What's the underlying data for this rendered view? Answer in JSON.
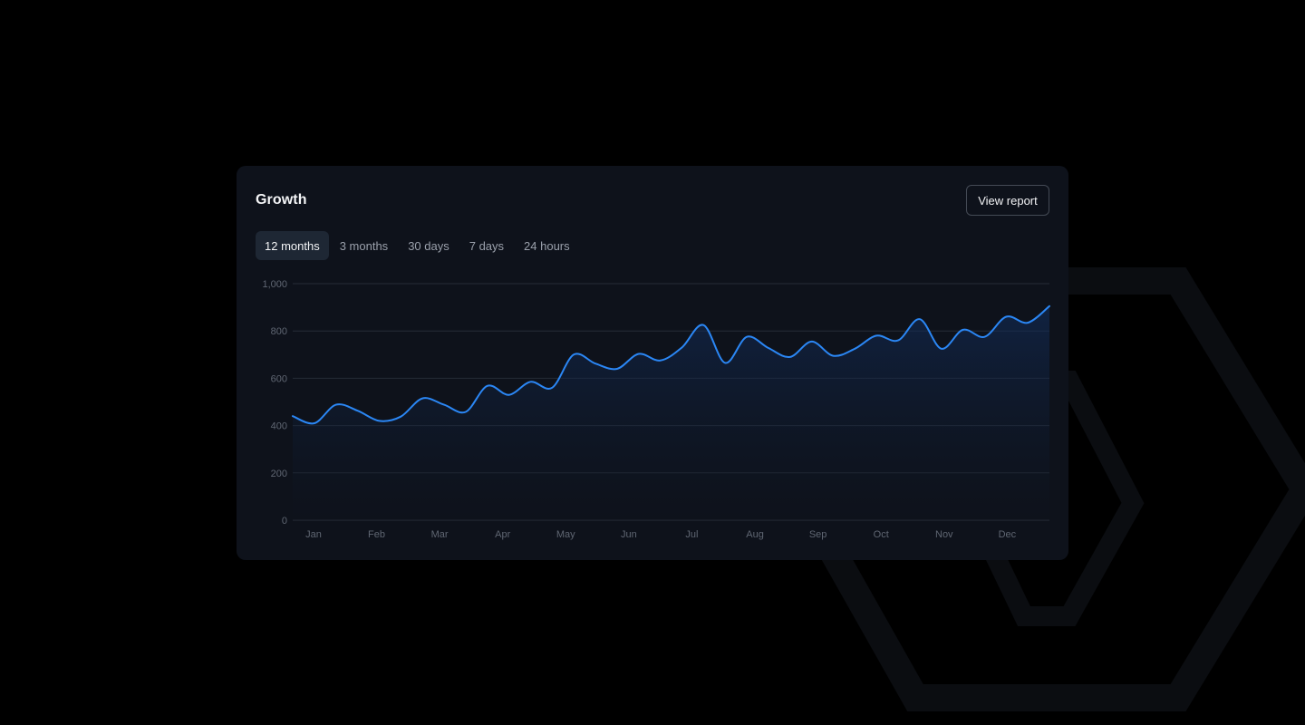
{
  "card": {
    "title": "Growth",
    "view_report_label": "View report",
    "tabs": [
      {
        "label": "12 months",
        "active": true
      },
      {
        "label": "3 months",
        "active": false
      },
      {
        "label": "30 days",
        "active": false
      },
      {
        "label": "7 days",
        "active": false
      },
      {
        "label": "24 hours",
        "active": false
      }
    ]
  },
  "colors": {
    "line": "#2b87f5",
    "grid": "#262c37",
    "card_bg": "#0e121b",
    "tab_active_bg": "#1e2734"
  },
  "chart_data": {
    "type": "area",
    "categories": [
      "Jan",
      "Feb",
      "Mar",
      "Apr",
      "May",
      "Jun",
      "Jul",
      "Aug",
      "Sep",
      "Oct",
      "Nov",
      "Dec"
    ],
    "y_ticks": [
      "0",
      "200",
      "400",
      "600",
      "800",
      "1,000"
    ],
    "ylim": [
      0,
      1000
    ],
    "grid": true,
    "series": [
      {
        "values": [
          440,
          410,
          488,
          463,
          420,
          438,
          515,
          488,
          458,
          568,
          530,
          585,
          560,
          700,
          662,
          640,
          703,
          675,
          730,
          825,
          665,
          775,
          728,
          690,
          755,
          695,
          725,
          780,
          760,
          850,
          725,
          805,
          775,
          860,
          835,
          905
        ]
      }
    ]
  }
}
